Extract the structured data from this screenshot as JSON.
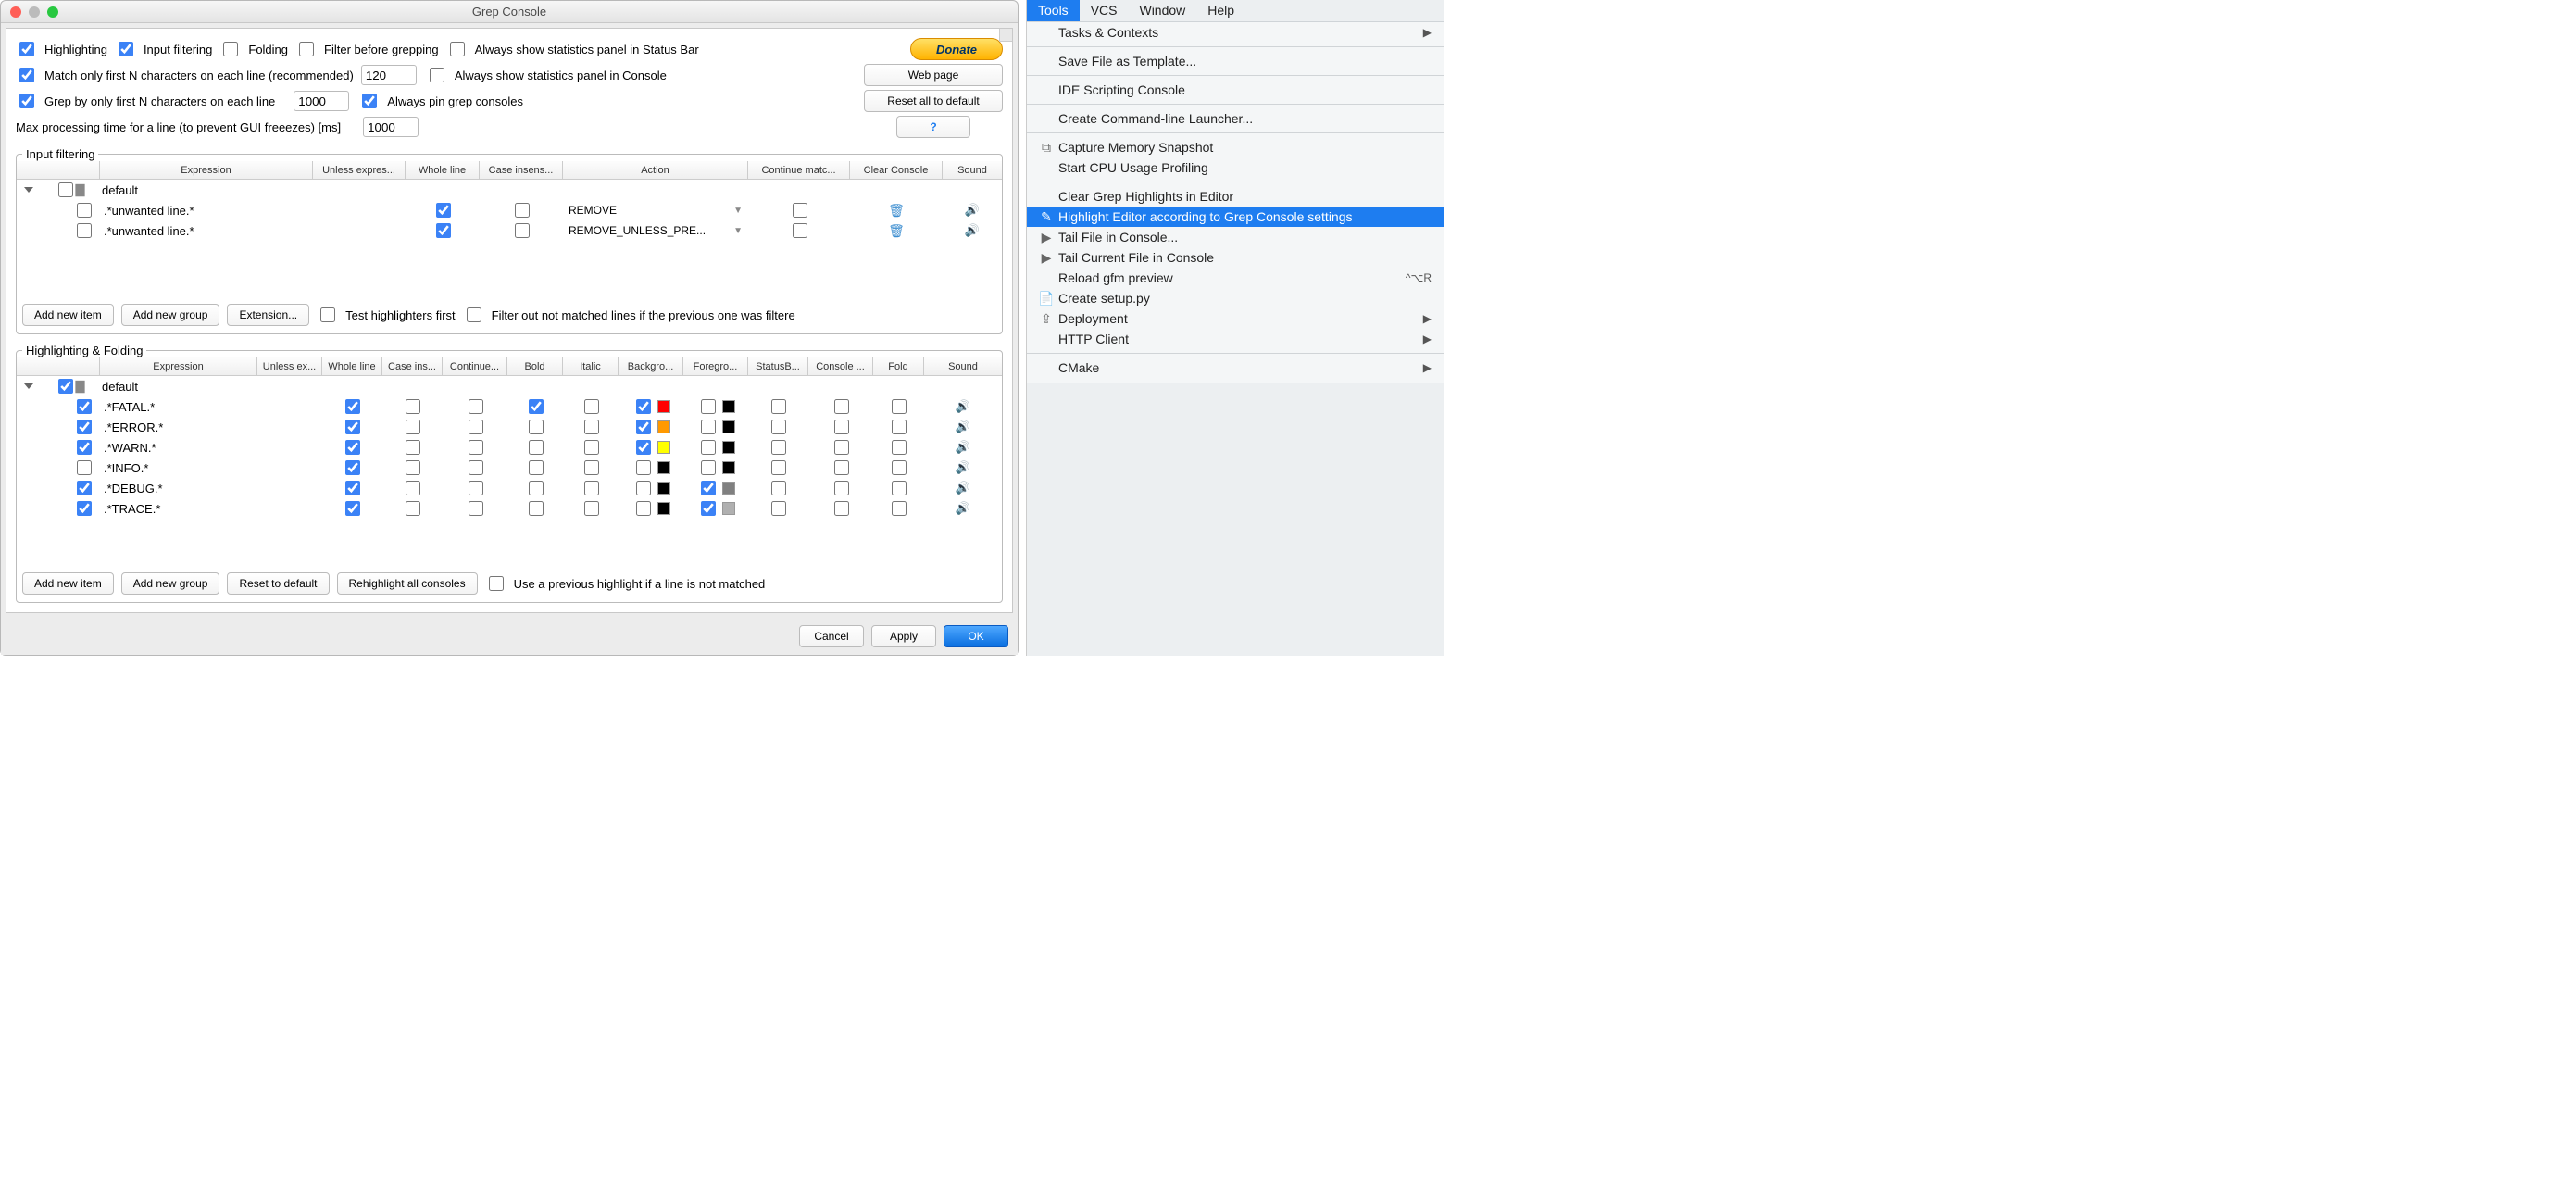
{
  "dialog": {
    "title": "Grep Console",
    "opt_row1": {
      "highlighting": "Highlighting",
      "input_filtering": "Input filtering",
      "folding": "Folding",
      "filter_before": "Filter before grepping",
      "always_statusbar": "Always show statistics panel in Status Bar"
    },
    "opt_row2": {
      "match_first_n": "Match only first N characters on each line (recommended)",
      "value": "120",
      "always_console": "Always show statistics panel in Console"
    },
    "opt_row3": {
      "grep_first_n": "Grep by only first N characters on each line",
      "value": "1000",
      "always_pin": "Always pin grep consoles"
    },
    "opt_row4": {
      "max_time": "Max processing time for a line (to prevent GUI freeezes) [ms]",
      "value": "1000"
    },
    "buttons": {
      "donate": "Donate",
      "web_page": "Web page",
      "reset_all": "Reset all to default",
      "help": "?"
    },
    "filter": {
      "legend": "Input filtering",
      "headers": [
        "",
        "",
        "Expression",
        "Unless expres...",
        "Whole line",
        "Case insens...",
        "Action",
        "Continue matc...",
        "Clear Console",
        "Sound"
      ],
      "group": "default",
      "rows": [
        {
          "expr": ".*unwanted line.*",
          "action": "REMOVE"
        },
        {
          "expr": ".*unwanted line.*",
          "action": "REMOVE_UNLESS_PRE..."
        }
      ],
      "btns": {
        "add_item": "Add new item",
        "add_group": "Add new group",
        "extension": "Extension...",
        "test_first": "Test highlighters first",
        "filter_out": "Filter out not matched lines if the previous one was filtere"
      }
    },
    "hilite": {
      "legend": "Highlighting & Folding",
      "headers": [
        "",
        "",
        "Expression",
        "Unless ex...",
        "Whole line",
        "Case ins...",
        "Continue...",
        "Bold",
        "Italic",
        "Backgro...",
        "Foregro...",
        "StatusB...",
        "Console ...",
        "Fold",
        "Sound"
      ],
      "group": "default",
      "rows": [
        {
          "on": true,
          "expr": ".*FATAL.*",
          "whole": true,
          "bold": true,
          "bg_on": true,
          "bg": "#ff0000",
          "fg": "#000000",
          "fg_on": false
        },
        {
          "on": true,
          "expr": ".*ERROR.*",
          "whole": true,
          "bold": false,
          "bg_on": true,
          "bg": "#ff9900",
          "fg": "#000000",
          "fg_on": false
        },
        {
          "on": true,
          "expr": ".*WARN.*",
          "whole": true,
          "bold": false,
          "bg_on": true,
          "bg": "#ffff00",
          "fg": "#000000",
          "fg_on": false
        },
        {
          "on": false,
          "expr": ".*INFO.*",
          "whole": true,
          "bold": false,
          "bg_on": false,
          "bg": "#000000",
          "fg": "#000000",
          "fg_on": false
        },
        {
          "on": true,
          "expr": ".*DEBUG.*",
          "whole": true,
          "bold": false,
          "bg_on": false,
          "bg": "#000000",
          "fg": "#808080",
          "fg_on": true
        },
        {
          "on": true,
          "expr": ".*TRACE.*",
          "whole": true,
          "bold": false,
          "bg_on": false,
          "bg": "#000000",
          "fg": "#b0b0b0",
          "fg_on": true
        }
      ],
      "btns": {
        "add_item": "Add new item",
        "add_group": "Add new group",
        "reset": "Reset to default",
        "rehighlight": "Rehighlight all consoles",
        "use_prev": "Use a previous highlight if a line is not matched"
      }
    },
    "footer": {
      "cancel": "Cancel",
      "apply": "Apply",
      "ok": "OK"
    }
  },
  "menu": {
    "bar": [
      "Tools",
      "VCS",
      "Window",
      "Help"
    ],
    "items": [
      {
        "t": "item",
        "label": "Tasks & Contexts",
        "arrow": true
      },
      {
        "t": "sep"
      },
      {
        "t": "item",
        "label": "Save File as Template..."
      },
      {
        "t": "sep"
      },
      {
        "t": "item",
        "label": "IDE Scripting Console"
      },
      {
        "t": "sep"
      },
      {
        "t": "item",
        "label": "Create Command-line Launcher..."
      },
      {
        "t": "sep"
      },
      {
        "t": "item",
        "label": "Capture Memory Snapshot",
        "icon": "snap"
      },
      {
        "t": "item",
        "label": "Start CPU Usage Profiling"
      },
      {
        "t": "sep"
      },
      {
        "t": "item",
        "label": "Clear Grep Highlights in Editor"
      },
      {
        "t": "item",
        "label": "Highlight Editor according to Grep Console settings",
        "highlight": true,
        "icon": "hilite"
      },
      {
        "t": "item",
        "label": "Tail File in Console...",
        "icon": "play"
      },
      {
        "t": "item",
        "label": "Tail Current File in Console",
        "icon": "play"
      },
      {
        "t": "item",
        "label": "Reload gfm preview",
        "shortcut": "^⌥R"
      },
      {
        "t": "item",
        "label": "Create setup.py",
        "icon": "setup"
      },
      {
        "t": "item",
        "label": "Deployment",
        "arrow": true,
        "icon": "deploy"
      },
      {
        "t": "item",
        "label": "HTTP Client",
        "arrow": true
      },
      {
        "t": "sep"
      },
      {
        "t": "item",
        "label": "CMake",
        "arrow": true
      }
    ]
  }
}
